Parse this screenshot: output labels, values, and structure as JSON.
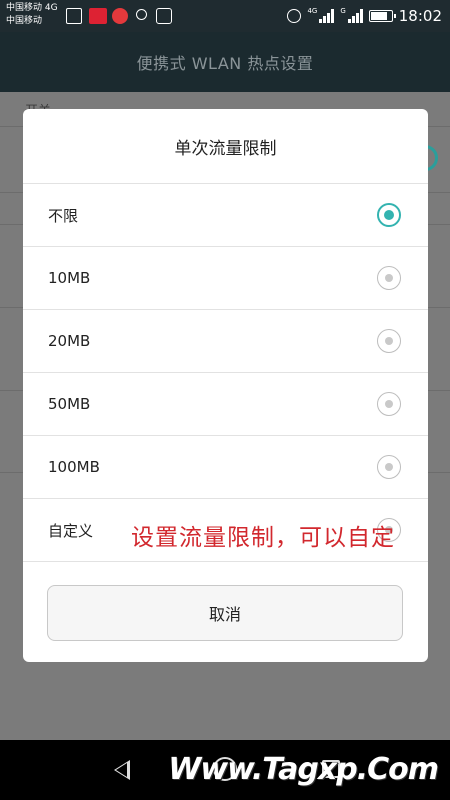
{
  "status_bar": {
    "carrier_line1": "中国移动 4G",
    "carrier_line2": "中国移动",
    "net_4g": "4G",
    "net_g": "G",
    "time": "18:02",
    "icons": [
      "image-icon",
      "youku-icon",
      "weibo-icon",
      "search-icon",
      "wifi-icon",
      "alarm-icon",
      "signal-icon",
      "battery-icon"
    ]
  },
  "app_bar": {
    "title": "便携式 WLAN 热点设置"
  },
  "background": {
    "partial_label": "开关"
  },
  "dialog": {
    "title": "单次流量限制",
    "options": [
      {
        "label": "不限",
        "selected": true
      },
      {
        "label": "10MB",
        "selected": false
      },
      {
        "label": "20MB",
        "selected": false
      },
      {
        "label": "50MB",
        "selected": false
      },
      {
        "label": "100MB",
        "selected": false
      },
      {
        "label": "自定义",
        "selected": false
      }
    ],
    "cancel_label": "取消"
  },
  "annotation": "设置流量限制，可以自定",
  "watermark": "Www.Tagxp.Com",
  "colors": {
    "accent": "#33b3b0",
    "annotation": "#d2282e",
    "app_bar": "#1b2a2f"
  }
}
